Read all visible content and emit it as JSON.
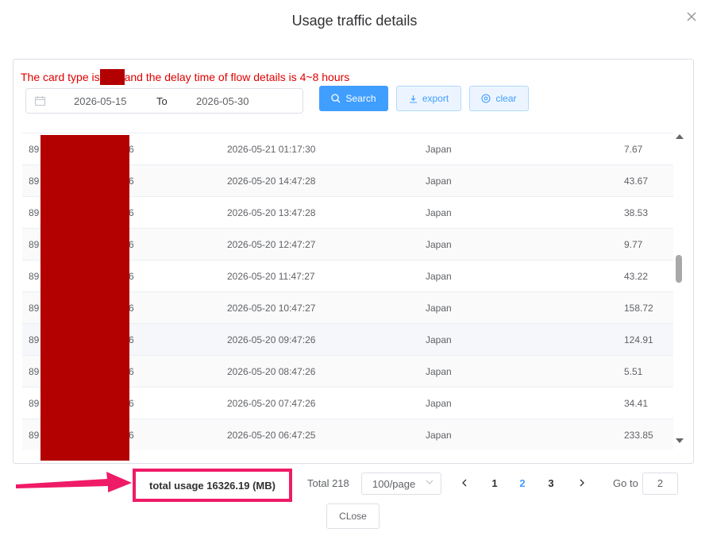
{
  "dialog": {
    "title": "Usage traffic details"
  },
  "notice": {
    "before": "The card type is",
    "after": "and the delay time of flow details is 4~8 hours"
  },
  "date_range": {
    "start": "2026-05-15",
    "separator": "To",
    "end": "2026-05-30"
  },
  "buttons": {
    "search": "Search",
    "export": "export",
    "clear": "clear",
    "close": "CLose"
  },
  "rows": [
    {
      "iccid_start": "89",
      "iccid_end": "6",
      "time": "2026-05-21 01:17:30",
      "region": "Japan",
      "usage": "7.67"
    },
    {
      "iccid_start": "89",
      "iccid_end": "6",
      "time": "2026-05-20 14:47:28",
      "region": "Japan",
      "usage": "43.67"
    },
    {
      "iccid_start": "89",
      "iccid_end": "6",
      "time": "2026-05-20 13:47:28",
      "region": "Japan",
      "usage": "38.53"
    },
    {
      "iccid_start": "89",
      "iccid_end": "6",
      "time": "2026-05-20 12:47:27",
      "region": "Japan",
      "usage": "9.77"
    },
    {
      "iccid_start": "89",
      "iccid_end": "6",
      "time": "2026-05-20 11:47:27",
      "region": "Japan",
      "usage": "43.22"
    },
    {
      "iccid_start": "89",
      "iccid_end": "6",
      "time": "2026-05-20 10:47:27",
      "region": "Japan",
      "usage": "158.72"
    },
    {
      "iccid_start": "89",
      "iccid_end": "6",
      "time": "2026-05-20 09:47:26",
      "region": "Japan",
      "usage": "124.91"
    },
    {
      "iccid_start": "89",
      "iccid_end": "6",
      "time": "2026-05-20 08:47:26",
      "region": "Japan",
      "usage": "5.51"
    },
    {
      "iccid_start": "89",
      "iccid_end": "6",
      "time": "2026-05-20 07:47:26",
      "region": "Japan",
      "usage": "34.41"
    },
    {
      "iccid_start": "89",
      "iccid_end": "6",
      "time": "2026-05-20 06:47:25",
      "region": "Japan",
      "usage": "233.85"
    }
  ],
  "summary": {
    "total_usage": "total usage 16326.19 (MB)"
  },
  "pagination": {
    "total": "Total 218",
    "page_size": "100/page",
    "pages": [
      "1",
      "2",
      "3"
    ],
    "current_page": "2",
    "goto_label": "Go to",
    "goto_value": "2"
  },
  "colors": {
    "primary": "#409eff",
    "warning_text": "#e00000",
    "redaction": "#b30000",
    "highlight": "#ef1b67"
  },
  "icons": {
    "close": "close-icon",
    "calendar": "calendar-icon",
    "search": "search-icon",
    "export": "download-icon",
    "clear": "clear-circle-icon"
  }
}
